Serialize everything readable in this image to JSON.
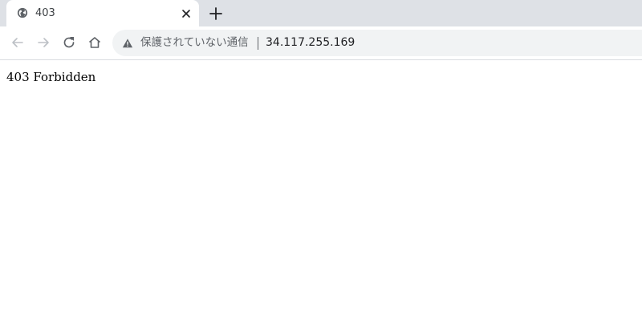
{
  "tab": {
    "title": "403",
    "favicon": "globe-icon",
    "close_icon": "close-icon"
  },
  "new_tab": {
    "icon": "plus-icon"
  },
  "toolbar": {
    "back_icon": "arrow-left-icon",
    "forward_icon": "arrow-right-icon",
    "reload_icon": "reload-icon",
    "home_icon": "home-icon"
  },
  "omnibox": {
    "security_icon": "warning-triangle-icon",
    "security_label": "保護されていない通信",
    "url": "34.117.255.169"
  },
  "page": {
    "body_text": "403 Forbidden"
  },
  "colors": {
    "tabstrip_bg": "#dee1e6",
    "omnibox_bg": "#f1f3f4",
    "icon_color": "#5f6368",
    "icon_disabled": "#bdc1c6"
  }
}
